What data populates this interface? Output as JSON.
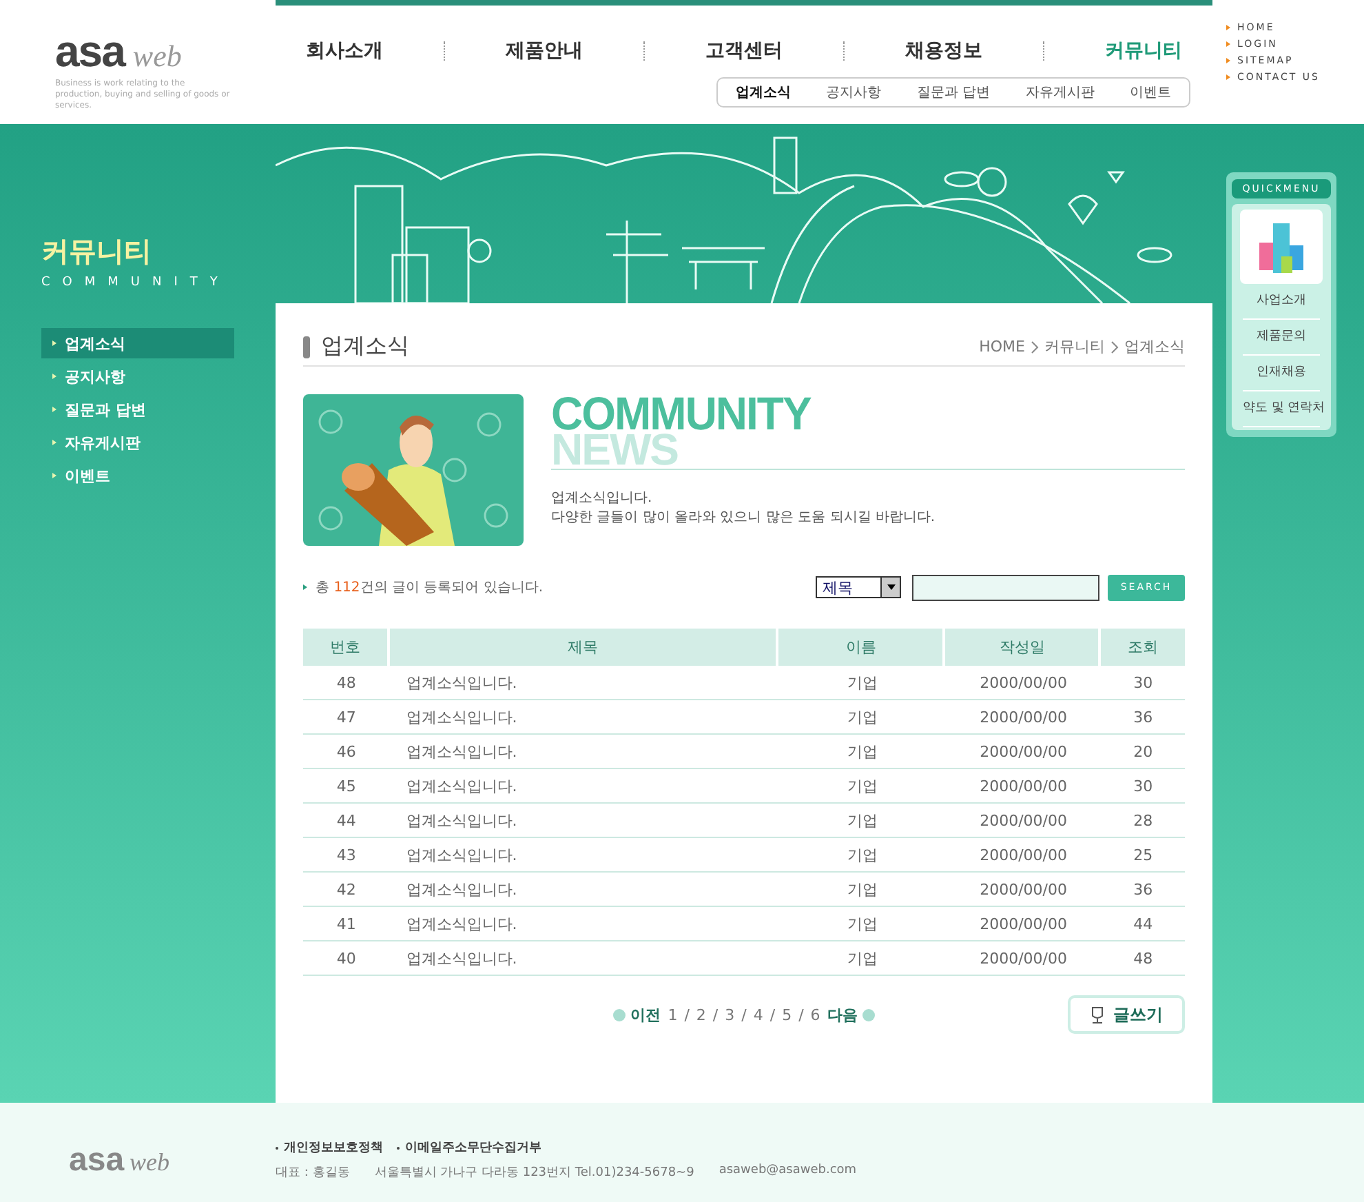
{
  "header": {
    "logo": {
      "brand": "asa",
      "suffix": "web",
      "tagline": "Business is work relating to the production, buying and selling of goods or services."
    },
    "nav": [
      {
        "label": "회사소개",
        "selected": false
      },
      {
        "label": "제품안내",
        "selected": false
      },
      {
        "label": "고객센터",
        "selected": false
      },
      {
        "label": "채용정보",
        "selected": false
      },
      {
        "label": "커뮤니티",
        "selected": true
      }
    ],
    "subnav": [
      {
        "label": "업계소식",
        "selected": true
      },
      {
        "label": "공지사항",
        "selected": false
      },
      {
        "label": "질문과 답변",
        "selected": false
      },
      {
        "label": "자유게시판",
        "selected": false
      },
      {
        "label": "이벤트",
        "selected": false
      }
    ],
    "utility_links": [
      "HOME",
      "LOGIN",
      "SITEMAP",
      "CONTACT US"
    ]
  },
  "sidebar": {
    "title": "커뮤니티",
    "subtitle": "COMMUNITY",
    "items": [
      {
        "label": "업계소식",
        "selected": true
      },
      {
        "label": "공지사항",
        "selected": false
      },
      {
        "label": "질문과 답변",
        "selected": false
      },
      {
        "label": "자유게시판",
        "selected": false
      },
      {
        "label": "이벤트",
        "selected": false
      }
    ]
  },
  "content": {
    "title": "업계소식",
    "breadcrumb": [
      "HOME",
      "커뮤니티",
      "업계소식"
    ],
    "banner": {
      "kind": "picture",
      "heading": "COMMUNITY",
      "subheading": "NEWS",
      "lines": [
        "업계소식입니다.",
        "다양한 글들이 많이 올라와 있으니 많은 도움 되시길 바랍니다."
      ]
    },
    "count_text": "총 **112**건의 글이 등록되어 있습니다.",
    "search": {
      "field": "제목",
      "button": "SEARCH"
    },
    "table": {
      "columns": [
        "번호",
        "제목",
        "이름",
        "작성일",
        "조회"
      ],
      "rows": [
        [
          "48",
          "업계소식입니다.",
          "기업",
          "2000/00/00",
          "30"
        ],
        [
          "47",
          "업계소식입니다.",
          "기업",
          "2000/00/00",
          "36"
        ],
        [
          "46",
          "업계소식입니다.",
          "기업",
          "2000/00/00",
          "20"
        ],
        [
          "45",
          "업계소식입니다.",
          "기업",
          "2000/00/00",
          "30"
        ],
        [
          "44",
          "업계소식입니다.",
          "기업",
          "2000/00/00",
          "28"
        ],
        [
          "43",
          "업계소식입니다.",
          "기업",
          "2000/00/00",
          "25"
        ],
        [
          "42",
          "업계소식입니다.",
          "기업",
          "2000/00/00",
          "36"
        ],
        [
          "41",
          "업계소식입니다.",
          "기업",
          "2000/00/00",
          "44"
        ],
        [
          "40",
          "업계소식입니다.",
          "기업",
          "2000/00/00",
          "48"
        ]
      ]
    },
    "pagination": {
      "prev": "이전",
      "pages": [
        "1",
        "2",
        "3",
        "4",
        "5",
        "6"
      ],
      "separator": "/",
      "next": "다음"
    },
    "write_button": "글쓰기"
  },
  "quick_menu": {
    "title": "QUICKMENU",
    "items": [
      "사업소개",
      "제품문의",
      "인재채용",
      "약도 및 연락처"
    ]
  },
  "footer": {
    "logo": {
      "brand": "asa",
      "suffix": "web"
    },
    "links": [
      "개인정보보호정책",
      "이메일주소무단수집거부"
    ],
    "address": [
      "대표 : 홍길동",
      "서울특별시 가나구 다라동 123번지 Tel.01)234-5678~9",
      "asaweb@asaweb.com"
    ]
  }
}
